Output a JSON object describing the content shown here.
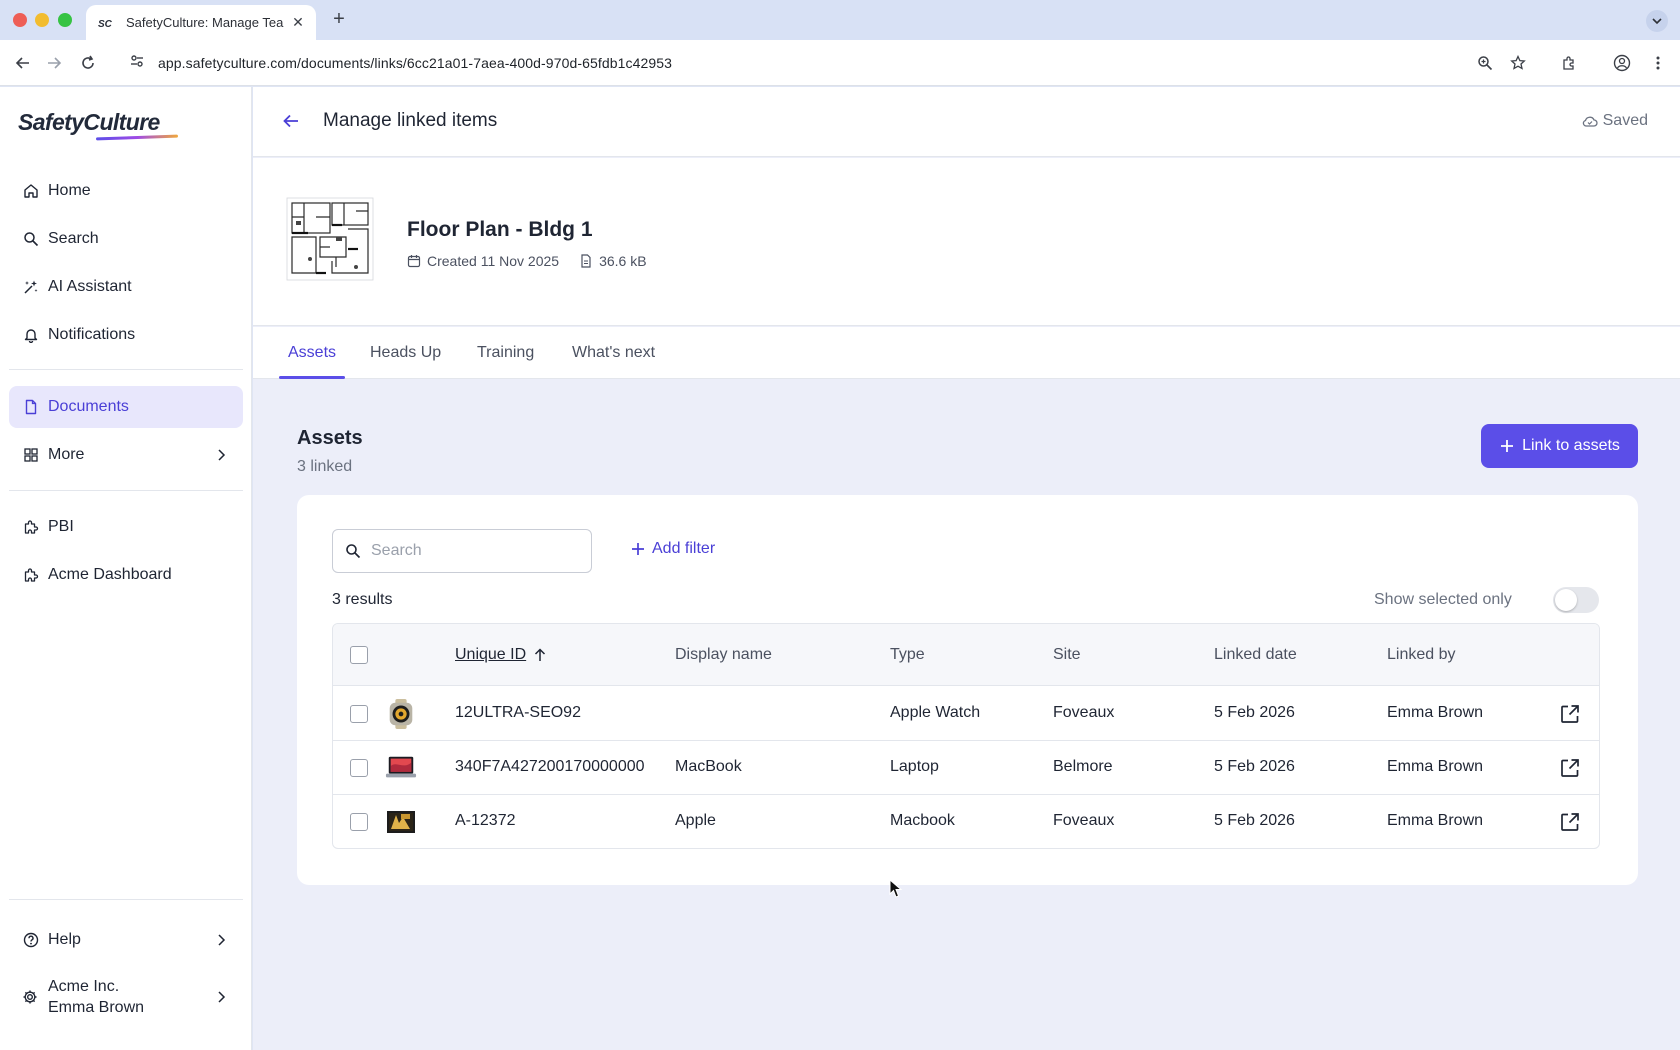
{
  "browser": {
    "tab_title": "SafetyCulture: Manage Teams",
    "url": "app.safetyculture.com/documents/links/6cc21a01-7aea-400d-970d-65fdb1c42953"
  },
  "sidebar": {
    "logo": "SafetyCulture",
    "items": [
      {
        "label": "Home",
        "icon": "home-icon"
      },
      {
        "label": "Search",
        "icon": "search-icon"
      },
      {
        "label": "AI Assistant",
        "icon": "sparkle-icon"
      },
      {
        "label": "Notifications",
        "icon": "bell-icon"
      },
      {
        "label": "Documents",
        "icon": "document-icon",
        "active": true
      },
      {
        "label": "More",
        "icon": "grid-icon"
      },
      {
        "label": "PBI",
        "icon": "puzzle-icon"
      },
      {
        "label": "Acme Dashboard",
        "icon": "puzzle-icon"
      }
    ],
    "help": "Help",
    "org": "Acme Inc.",
    "user": "Emma Brown"
  },
  "header": {
    "title": "Manage linked items",
    "saved": "Saved"
  },
  "document": {
    "title": "Floor Plan - Bldg 1",
    "created": "Created 11 Nov 2025",
    "size": "36.6 kB"
  },
  "tabs": [
    "Assets",
    "Heads Up",
    "Training",
    "What's next"
  ],
  "assets": {
    "title": "Assets",
    "count": "3 linked",
    "link_button": "Link to assets",
    "search_placeholder": "Search",
    "add_filter": "Add filter",
    "results": "3 results",
    "show_selected": "Show selected only",
    "show_selected_on": false,
    "columns": [
      "Unique ID",
      "Display name",
      "Type",
      "Site",
      "Linked date",
      "Linked by"
    ],
    "rows": [
      {
        "thumb": "watch",
        "id": "12ULTRA-SEO92",
        "name": "",
        "type": "Apple Watch",
        "site": "Foveaux",
        "date": "5 Feb 2026",
        "by": "Emma Brown"
      },
      {
        "thumb": "laptop",
        "id": "340F7A427200170000000",
        "name": "MacBook",
        "type": "Laptop",
        "site": "Belmore",
        "date": "5 Feb 2026",
        "by": "Emma Brown"
      },
      {
        "thumb": "box",
        "id": "A-12372",
        "name": "Apple",
        "type": "Macbook",
        "site": "Foveaux",
        "date": "5 Feb 2026",
        "by": "Emma Brown"
      }
    ]
  },
  "colors": {
    "accent": "#5b4ee8",
    "accent_text": "#4a3fd6",
    "active_nav_bg": "#e8e7fc",
    "content_bg": "#eceef9"
  }
}
